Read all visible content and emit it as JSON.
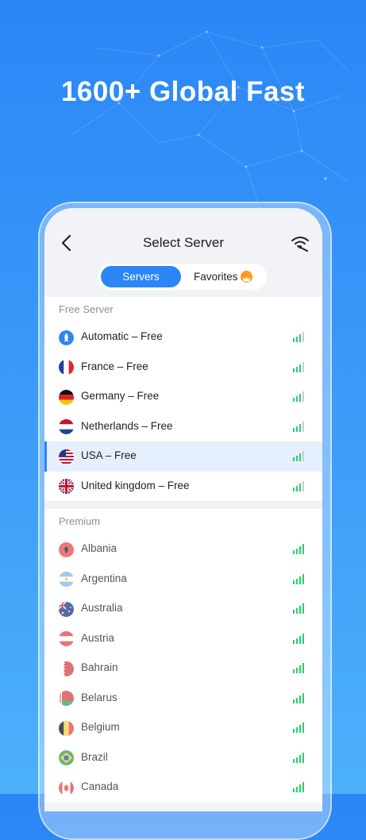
{
  "headline": "1600+ Global Fast",
  "header": {
    "title": "Select Server"
  },
  "tabs": {
    "servers": "Servers",
    "favorites": "Favorites"
  },
  "colors": {
    "accent": "#2b86f6",
    "signal": "#2ecc71",
    "selected_bg": "#e6effd"
  },
  "free_section": {
    "title": "Free Server",
    "servers": [
      {
        "label": "Automatic – Free",
        "icon": "rocket-icon"
      },
      {
        "label": "France – Free",
        "icon": "france-flag-icon"
      },
      {
        "label": "Germany – Free",
        "icon": "germany-flag-icon"
      },
      {
        "label": "Netherlands – Free",
        "icon": "netherlands-flag-icon"
      },
      {
        "label": "USA – Free",
        "icon": "usa-flag-icon",
        "selected": true
      },
      {
        "label": "United kingdom – Free",
        "icon": "uk-flag-icon"
      }
    ]
  },
  "premium_section": {
    "title": "Premium",
    "servers": [
      {
        "label": "Albania",
        "icon": "albania-flag-icon"
      },
      {
        "label": "Argentina",
        "icon": "argentina-flag-icon"
      },
      {
        "label": "Australia",
        "icon": "australia-flag-icon"
      },
      {
        "label": "Austria",
        "icon": "austria-flag-icon"
      },
      {
        "label": "Bahrain",
        "icon": "bahrain-flag-icon"
      },
      {
        "label": "Belarus",
        "icon": "belarus-flag-icon"
      },
      {
        "label": "Belgium",
        "icon": "belgium-flag-icon"
      },
      {
        "label": "Brazil",
        "icon": "brazil-flag-icon"
      },
      {
        "label": "Canada",
        "icon": "canada-flag-icon"
      }
    ]
  }
}
